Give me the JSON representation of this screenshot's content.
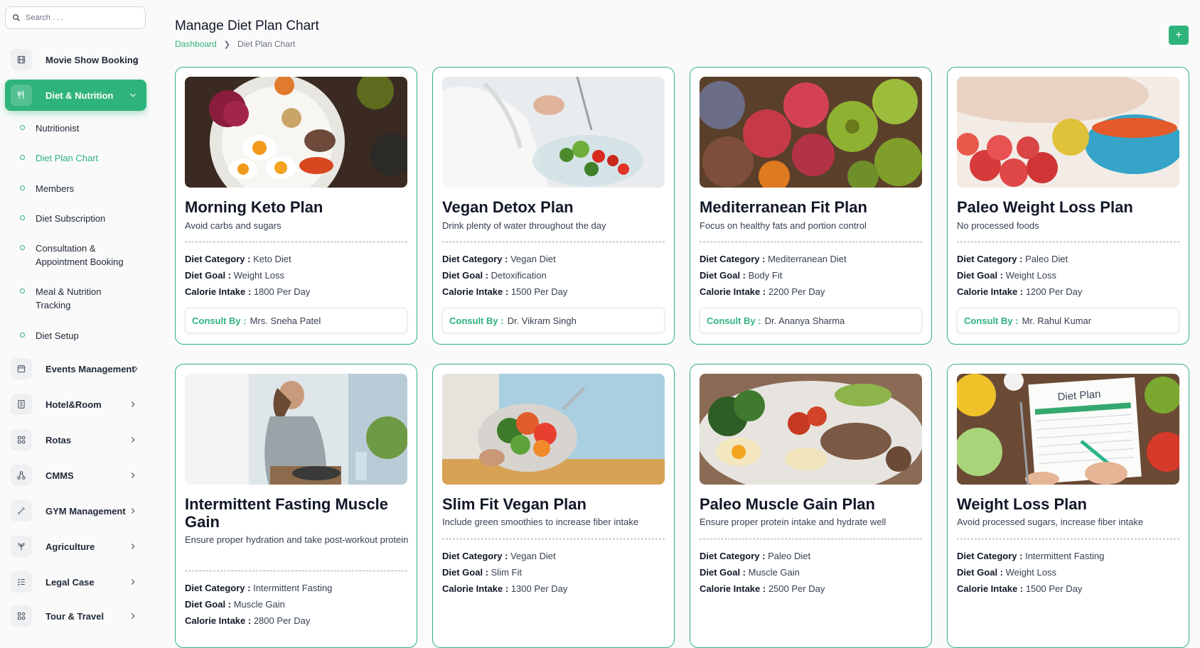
{
  "search": {
    "placeholder": "Search . . ."
  },
  "sidebar": {
    "items": [
      {
        "label": "Movie Show Booking",
        "icon": "film-icon"
      },
      {
        "label": "Diet & Nutrition",
        "icon": "utensils-icon",
        "active": true
      },
      {
        "label": "Events Management",
        "icon": "calendar-icon"
      },
      {
        "label": "Hotel&Room",
        "icon": "building-icon"
      },
      {
        "label": "Rotas",
        "icon": "grid-icon"
      },
      {
        "label": "CMMS",
        "icon": "network-icon"
      },
      {
        "label": "GYM Management",
        "icon": "dumbbell-icon"
      },
      {
        "label": "Agriculture",
        "icon": "plant-icon"
      },
      {
        "label": "Legal Case",
        "icon": "list-check-icon"
      },
      {
        "label": "Tour & Travel",
        "icon": "apps-icon"
      }
    ],
    "sub_items": [
      {
        "label": "Nutritionist"
      },
      {
        "label": "Diet Plan Chart",
        "active": true
      },
      {
        "label": "Members"
      },
      {
        "label": "Diet Subscription"
      },
      {
        "label": "Consultation & Appointment Booking"
      },
      {
        "label": "Meal & Nutrition Tracking"
      },
      {
        "label": "Diet Setup"
      }
    ]
  },
  "header": {
    "title": "Manage Diet Plan Chart",
    "breadcrumb": [
      "Dashboard",
      "Diet Plan Chart"
    ],
    "add_label": "+"
  },
  "labels": {
    "category": "Diet Category :",
    "goal": "Diet Goal :",
    "calorie": "Calorie Intake :",
    "consult": "Consult By :"
  },
  "cards": [
    {
      "title": "Morning Keto Plan",
      "desc": "Avoid carbs and sugars",
      "category": "Keto Diet",
      "goal": "Weight Loss",
      "calorie": "1800 Per Day",
      "consult": "Mrs. Sneha Patel"
    },
    {
      "title": "Vegan Detox Plan",
      "desc": "Drink plenty of water throughout the day",
      "category": "Vegan Diet",
      "goal": "Detoxification",
      "calorie": "1500 Per Day",
      "consult": "Dr. Vikram Singh"
    },
    {
      "title": "Mediterranean Fit Plan",
      "desc": "Focus on healthy fats and portion control",
      "category": "Mediterranean Diet",
      "goal": "Body Fit",
      "calorie": "2200 Per Day",
      "consult": "Dr. Ananya Sharma"
    },
    {
      "title": "Paleo Weight Loss Plan",
      "desc": "No processed foods",
      "category": "Paleo Diet",
      "goal": "Weight Loss",
      "calorie": "1200 Per Day",
      "consult": "Mr. Rahul Kumar"
    },
    {
      "title": "Intermittent Fasting Muscle Gain",
      "desc": "Ensure proper hydration and take post-workout protein",
      "category": "Intermittent Fasting",
      "goal": "Muscle Gain",
      "calorie": "2800 Per Day"
    },
    {
      "title": "Slim Fit Vegan Plan",
      "desc": "Include green smoothies to increase fiber intake",
      "category": "Vegan Diet",
      "goal": "Slim Fit",
      "calorie": "1300 Per Day"
    },
    {
      "title": "Paleo Muscle Gain Plan",
      "desc": "Ensure proper protein intake and hydrate well",
      "category": "Paleo Diet",
      "goal": "Muscle Gain",
      "calorie": "2500 Per Day"
    },
    {
      "title": "Weight Loss Plan",
      "desc": "Avoid processed sugars, increase fiber intake",
      "category": "Intermittent Fasting",
      "goal": "Weight Loss",
      "calorie": "1500 Per Day",
      "image_text": "Diet Plan"
    }
  ],
  "colors": {
    "accent": "#2fb37c",
    "text": "#111827",
    "muted": "#6b7280"
  }
}
